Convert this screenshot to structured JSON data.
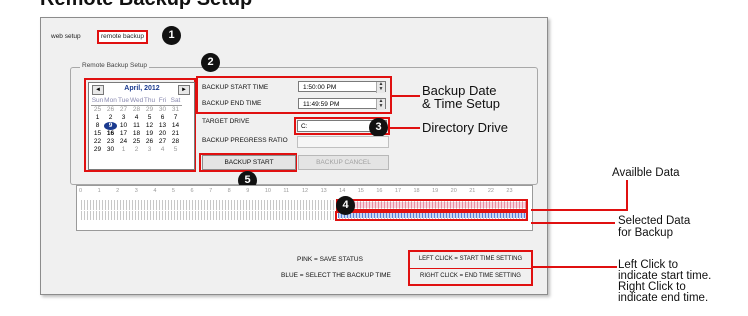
{
  "page_heading": "Remote Backup Setup",
  "tabs": [
    {
      "label": "web setup"
    },
    {
      "label": "remote backup"
    }
  ],
  "markers": [
    "1",
    "2",
    "3",
    "4",
    "5"
  ],
  "group_label": "Remote Backup Setup",
  "calendar": {
    "month_label": "April, 2012",
    "prev": "◄",
    "next": "►",
    "weekdays": [
      "Sun",
      "Mon",
      "Tue",
      "Wed",
      "Thu",
      "Fri",
      "Sat"
    ],
    "weeks": [
      [
        "25",
        "26",
        "27",
        "28",
        "29",
        "30",
        "31"
      ],
      [
        "1",
        "2",
        "3",
        "4",
        "5",
        "6",
        "7"
      ],
      [
        "8",
        "9",
        "10",
        "11",
        "12",
        "13",
        "14"
      ],
      [
        "15",
        "16",
        "17",
        "18",
        "19",
        "20",
        "21"
      ],
      [
        "22",
        "23",
        "24",
        "25",
        "26",
        "27",
        "28"
      ],
      [
        "29",
        "30",
        "1",
        "2",
        "3",
        "4",
        "5"
      ]
    ],
    "selected_day": "9",
    "today_day": "16"
  },
  "form": {
    "start_time_label": "BACKUP START TIME",
    "start_time_value": "1:50:00 PM",
    "end_time_label": "BACKUP END TIME",
    "end_time_value": "11:49:59 PM",
    "target_drive_label": "TARGET DRIVE",
    "target_drive_value": "C:",
    "progress_label": "BACKUP PREGRESS RATIO",
    "backup_start": "BACKUP START",
    "backup_cancel": "BACKUP CANCEL"
  },
  "timeline": {
    "hours": [
      "0",
      "1",
      "2",
      "3",
      "4",
      "5",
      "6",
      "7",
      "8",
      "9",
      "10",
      "11",
      "12",
      "13",
      "14",
      "15",
      "16",
      "17",
      "18",
      "19",
      "20",
      "21",
      "22",
      "23"
    ],
    "available_start_hour": 13.9,
    "available_end_hour": 24,
    "selected_start_hour": 13.83,
    "selected_end_hour": 24
  },
  "legend": {
    "pink": "PINK = SAVE STATUS",
    "blue": "BLUE = SELECT THE BACKUP TIME",
    "left_click": "LEFT CLICK = START TIME SETTING",
    "right_click": "RIGHT CLICK = END TIME SETTING"
  },
  "annotations": {
    "date_time_1": "Backup Date",
    "date_time_2": "& Time Setup",
    "directory": "Directory Drive",
    "available": "Availble Data",
    "selected_1": "Selected Data",
    "selected_2": "for Backup",
    "click_1": "Left Click to",
    "click_2": "indicate start time.",
    "click_3": "Right Click to",
    "click_4": "indicate end time."
  },
  "colors": {
    "highlight": "#e01010",
    "pink_status": "#e88aa0",
    "blue_selection": "#5a80d6",
    "calendar_accent": "#1a3a8f"
  }
}
